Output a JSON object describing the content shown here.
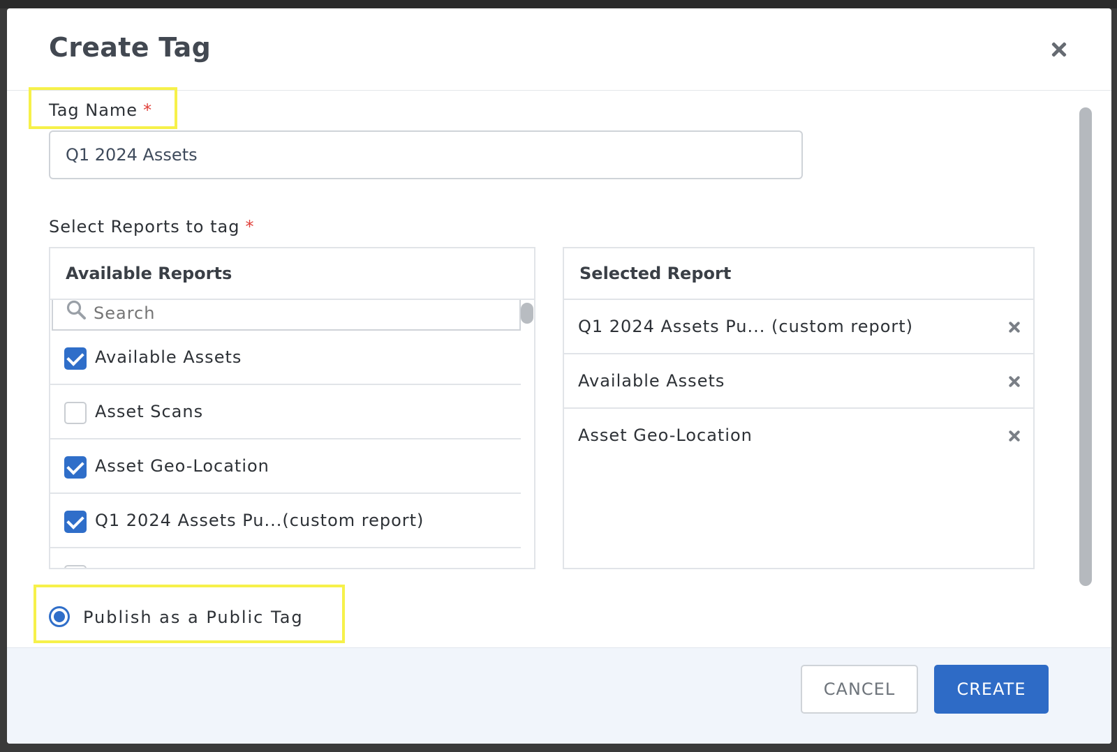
{
  "modal": {
    "title": "Create Tag"
  },
  "tag_name": {
    "label": "Tag Name",
    "required_mark": "*",
    "value": "Q1 2024 Assets"
  },
  "select_reports": {
    "label": "Select Reports to tag",
    "required_mark": "*"
  },
  "available_reports": {
    "header": "Available Reports",
    "search_placeholder": "Search",
    "items": [
      {
        "label": "Available Assets",
        "checked": true
      },
      {
        "label": "Asset Scans",
        "checked": false
      },
      {
        "label": "Asset Geo-Location",
        "checked": true
      },
      {
        "label": "Q1 2024 Assets Pu...(custom report)",
        "checked": true
      }
    ]
  },
  "selected_report": {
    "header": "Selected Report",
    "items": [
      {
        "label": "Q1 2024 Assets Pu... (custom report)"
      },
      {
        "label": "Available Assets"
      },
      {
        "label": "Asset Geo-Location"
      }
    ]
  },
  "publish": {
    "label": "Publish as a Public Tag",
    "selected": true
  },
  "footer": {
    "cancel_label": "CANCEL",
    "create_label": "CREATE"
  },
  "colors": {
    "primary": "#2e6bc6",
    "highlight": "#f6f14a",
    "required": "#e0403a"
  }
}
